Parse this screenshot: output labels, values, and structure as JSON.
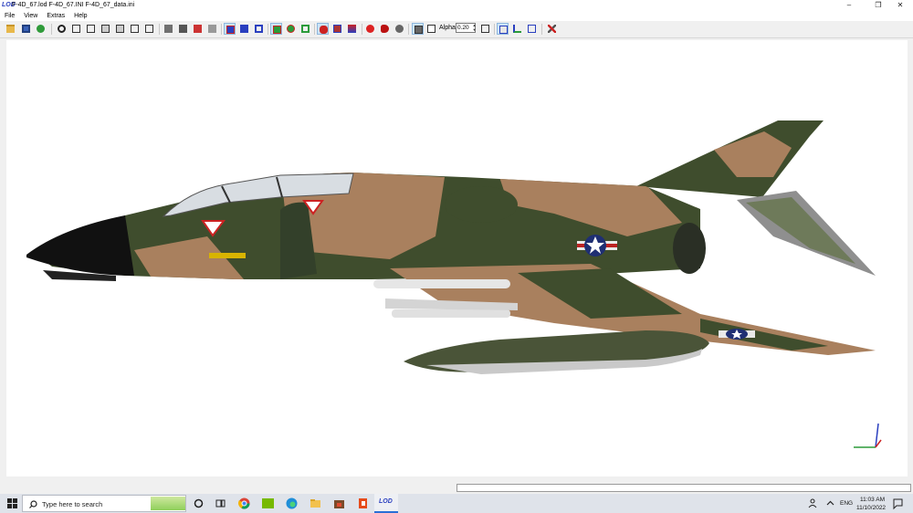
{
  "window": {
    "app_badge": "LOD",
    "title": "F-4D_67.lod  F-4D_67.INI  F-4D_67_data.ini",
    "controls": {
      "minimize": "–",
      "restore": "❐",
      "close": "✕"
    }
  },
  "menu": {
    "items": [
      "File",
      "View",
      "Extras",
      "Help"
    ]
  },
  "toolbar": {
    "alpha_label": "Alpha:",
    "alpha_value": "0.20",
    "spin_up": "▲",
    "spin_down": "▼"
  },
  "taskbar": {
    "search_placeholder": "Type here to search",
    "lod_badge": "LOD",
    "language": "ENG",
    "time": "11:03 AM",
    "date": "11/10/2022"
  },
  "colors": {
    "camo_green": "#3f4d2d",
    "camo_tan": "#a9805e",
    "nose": "#111111",
    "tank": "#4a5438",
    "selected_tool": "#cce4f7",
    "viewport": "#ffffff"
  }
}
